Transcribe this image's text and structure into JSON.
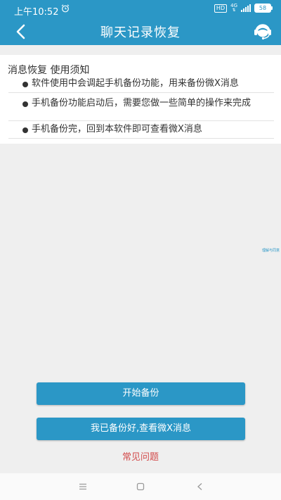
{
  "status": {
    "time": "上午10:52",
    "hd": "HD",
    "network": "4G",
    "battery": "58",
    "alarm_icon": "alarm-clock-icon",
    "signal_icon": "signal-bars-icon"
  },
  "header": {
    "title": "聊天记录恢复",
    "back_icon": "chevron-left-icon",
    "service_icon": "customer-service-icon",
    "bg_color": "#2b97c6"
  },
  "notice": {
    "title": "消息恢复 使用须知",
    "items": [
      "软件使用中会调起手机备份功能，用来备份微X消息",
      "手机备份功能启动后，需要您做一些简单的操作来完成",
      "手机备份完，回到本软件即可查看微X消息"
    ]
  },
  "side_note": "理解与同意",
  "actions": {
    "start_backup": "开始备份",
    "view_messages": "我已备份好,查看微X消息",
    "faq": "常见问题",
    "button_color": "#2b97c6",
    "faq_color": "#d24a4a"
  },
  "navbar": {
    "menu_icon": "menu-lines-icon",
    "home_icon": "home-square-icon",
    "back_icon": "back-triangle-icon"
  }
}
